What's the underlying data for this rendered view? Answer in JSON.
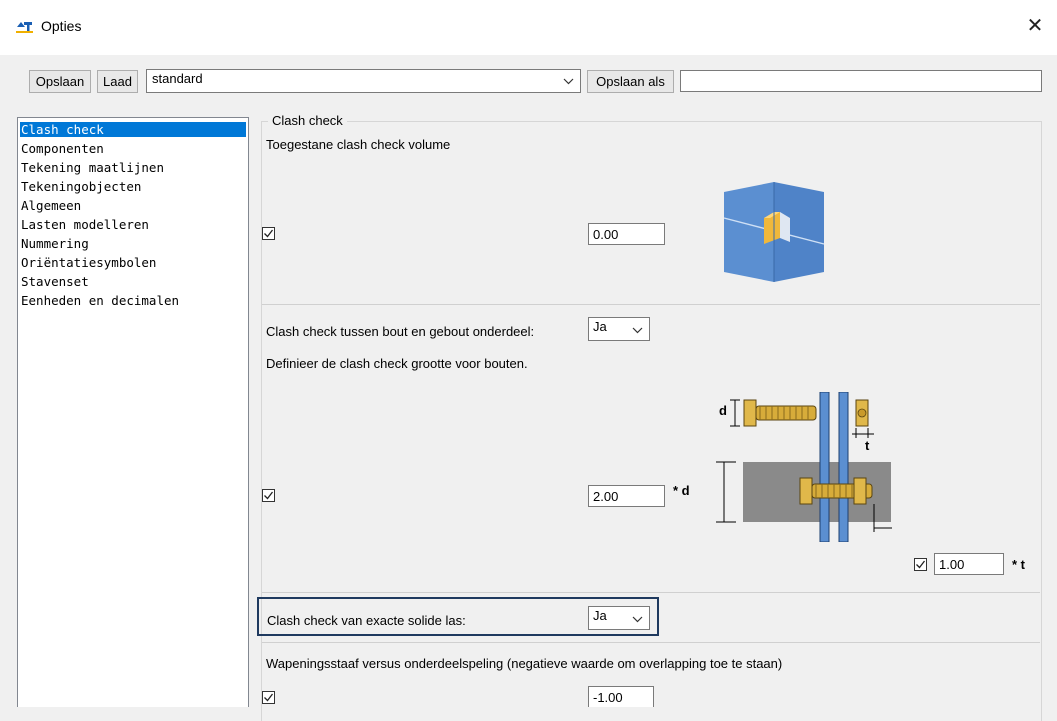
{
  "window": {
    "title": "Opties",
    "close_symbol": "✕"
  },
  "toolbar": {
    "save_label": "Opslaan",
    "load_label": "Laad",
    "preset_value": "standard",
    "save_as_label": "Opslaan als",
    "save_as_name": ""
  },
  "sidebar": {
    "items": [
      {
        "label": "Clash check",
        "selected": true
      },
      {
        "label": "Componenten"
      },
      {
        "label": "Tekening maatlijnen"
      },
      {
        "label": "Tekeningobjecten"
      },
      {
        "label": "Algemeen"
      },
      {
        "label": "Lasten modelleren"
      },
      {
        "label": "Nummering"
      },
      {
        "label": "Oriëntatiesymbolen"
      },
      {
        "label": "Stavenset"
      },
      {
        "label": "Eenheden en decimalen"
      }
    ]
  },
  "main": {
    "group_title": "Clash check",
    "volume": {
      "label": "Toegestane clash check volume",
      "checked": true,
      "value": "0.00"
    },
    "bolt_clash": {
      "label": "Clash check tussen bout en gebout onderdeel:",
      "value": "Ja"
    },
    "bolt_size": {
      "label": "Definieer de clash check grootte voor bouten.",
      "d_checked": true,
      "d_value": "2.00",
      "d_unit": "* d",
      "t_checked": true,
      "t_value": "1.00",
      "t_unit": "* t",
      "diagram_label_d": "d",
      "diagram_label_t": "t"
    },
    "weld_clash": {
      "label": "Clash check van exacte solide las:",
      "value": "Ja"
    },
    "rebar": {
      "label": "Wapeningsstaaf versus onderdeelspeling (negatieve waarde om overlapping toe te staan)",
      "checked": true,
      "value": "-1.00"
    }
  },
  "colors": {
    "selection": "#0078d7",
    "plate_blue": "#5b8fd1",
    "clash_orange": "#f0b83c",
    "bolt_gold": "#e0b84a",
    "plate_gray": "#8a8a8a",
    "highlight_frame": "#1f3a5f"
  }
}
